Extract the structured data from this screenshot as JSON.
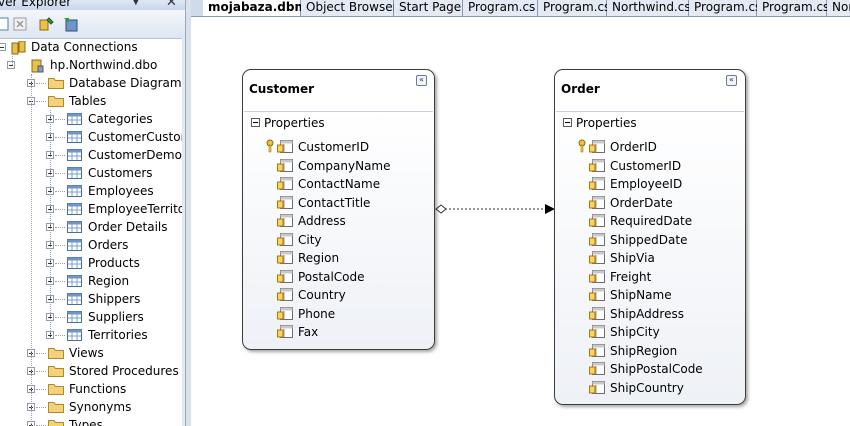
{
  "explorer": {
    "title": "ver Explorer",
    "pin_glyph": "▼",
    "close_glyph": "✕",
    "toolbar": [
      "refresh-icon",
      "stop-icon",
      "connect-to-database-icon",
      "connect-to-server-icon"
    ],
    "tree": {
      "root": "Data Connections",
      "connection": "hp.Northwind.dbo",
      "folders_before": [
        "Database Diagrams"
      ],
      "tables_label": "Tables",
      "tables": [
        "Categories",
        "CustomerCustom",
        "CustomerDemogr",
        "Customers",
        "Employees",
        "EmployeeTerritori",
        "Order Details",
        "Orders",
        "Products",
        "Region",
        "Shippers",
        "Suppliers",
        "Territories"
      ],
      "folders_after": [
        "Views",
        "Stored Procedures",
        "Functions",
        "Synonyms",
        "Types"
      ]
    }
  },
  "tabs": [
    {
      "label": "mojabaza.dbml*",
      "active": true
    },
    {
      "label": "Object Browser",
      "active": false
    },
    {
      "label": "Start Page",
      "active": false
    },
    {
      "label": "Program.cs",
      "active": false
    },
    {
      "label": "Program.cs",
      "active": false
    },
    {
      "label": "Northwind.cs",
      "active": false
    },
    {
      "label": "Program.cs",
      "active": false
    },
    {
      "label": "Program.cs",
      "active": false
    },
    {
      "label": "Nort",
      "active": false
    }
  ],
  "entities": {
    "customer": {
      "title": "Customer",
      "collapse_glyph": "«",
      "properties_label": "Properties",
      "properties": [
        "CustomerID",
        "CompanyName",
        "ContactName",
        "ContactTitle",
        "Address",
        "City",
        "Region",
        "PostalCode",
        "Country",
        "Phone",
        "Fax"
      ],
      "key_property": "CustomerID"
    },
    "order": {
      "title": "Order",
      "collapse_glyph": "«",
      "properties_label": "Properties",
      "properties": [
        "OrderID",
        "CustomerID",
        "EmployeeID",
        "OrderDate",
        "RequiredDate",
        "ShippedDate",
        "ShipVia",
        "Freight",
        "ShipName",
        "ShipAddress",
        "ShipCity",
        "ShipRegion",
        "ShipPostalCode",
        "ShipCountry"
      ],
      "key_property": "OrderID"
    }
  },
  "association": {
    "from": "Customer",
    "to": "Order",
    "style": "dashed"
  }
}
